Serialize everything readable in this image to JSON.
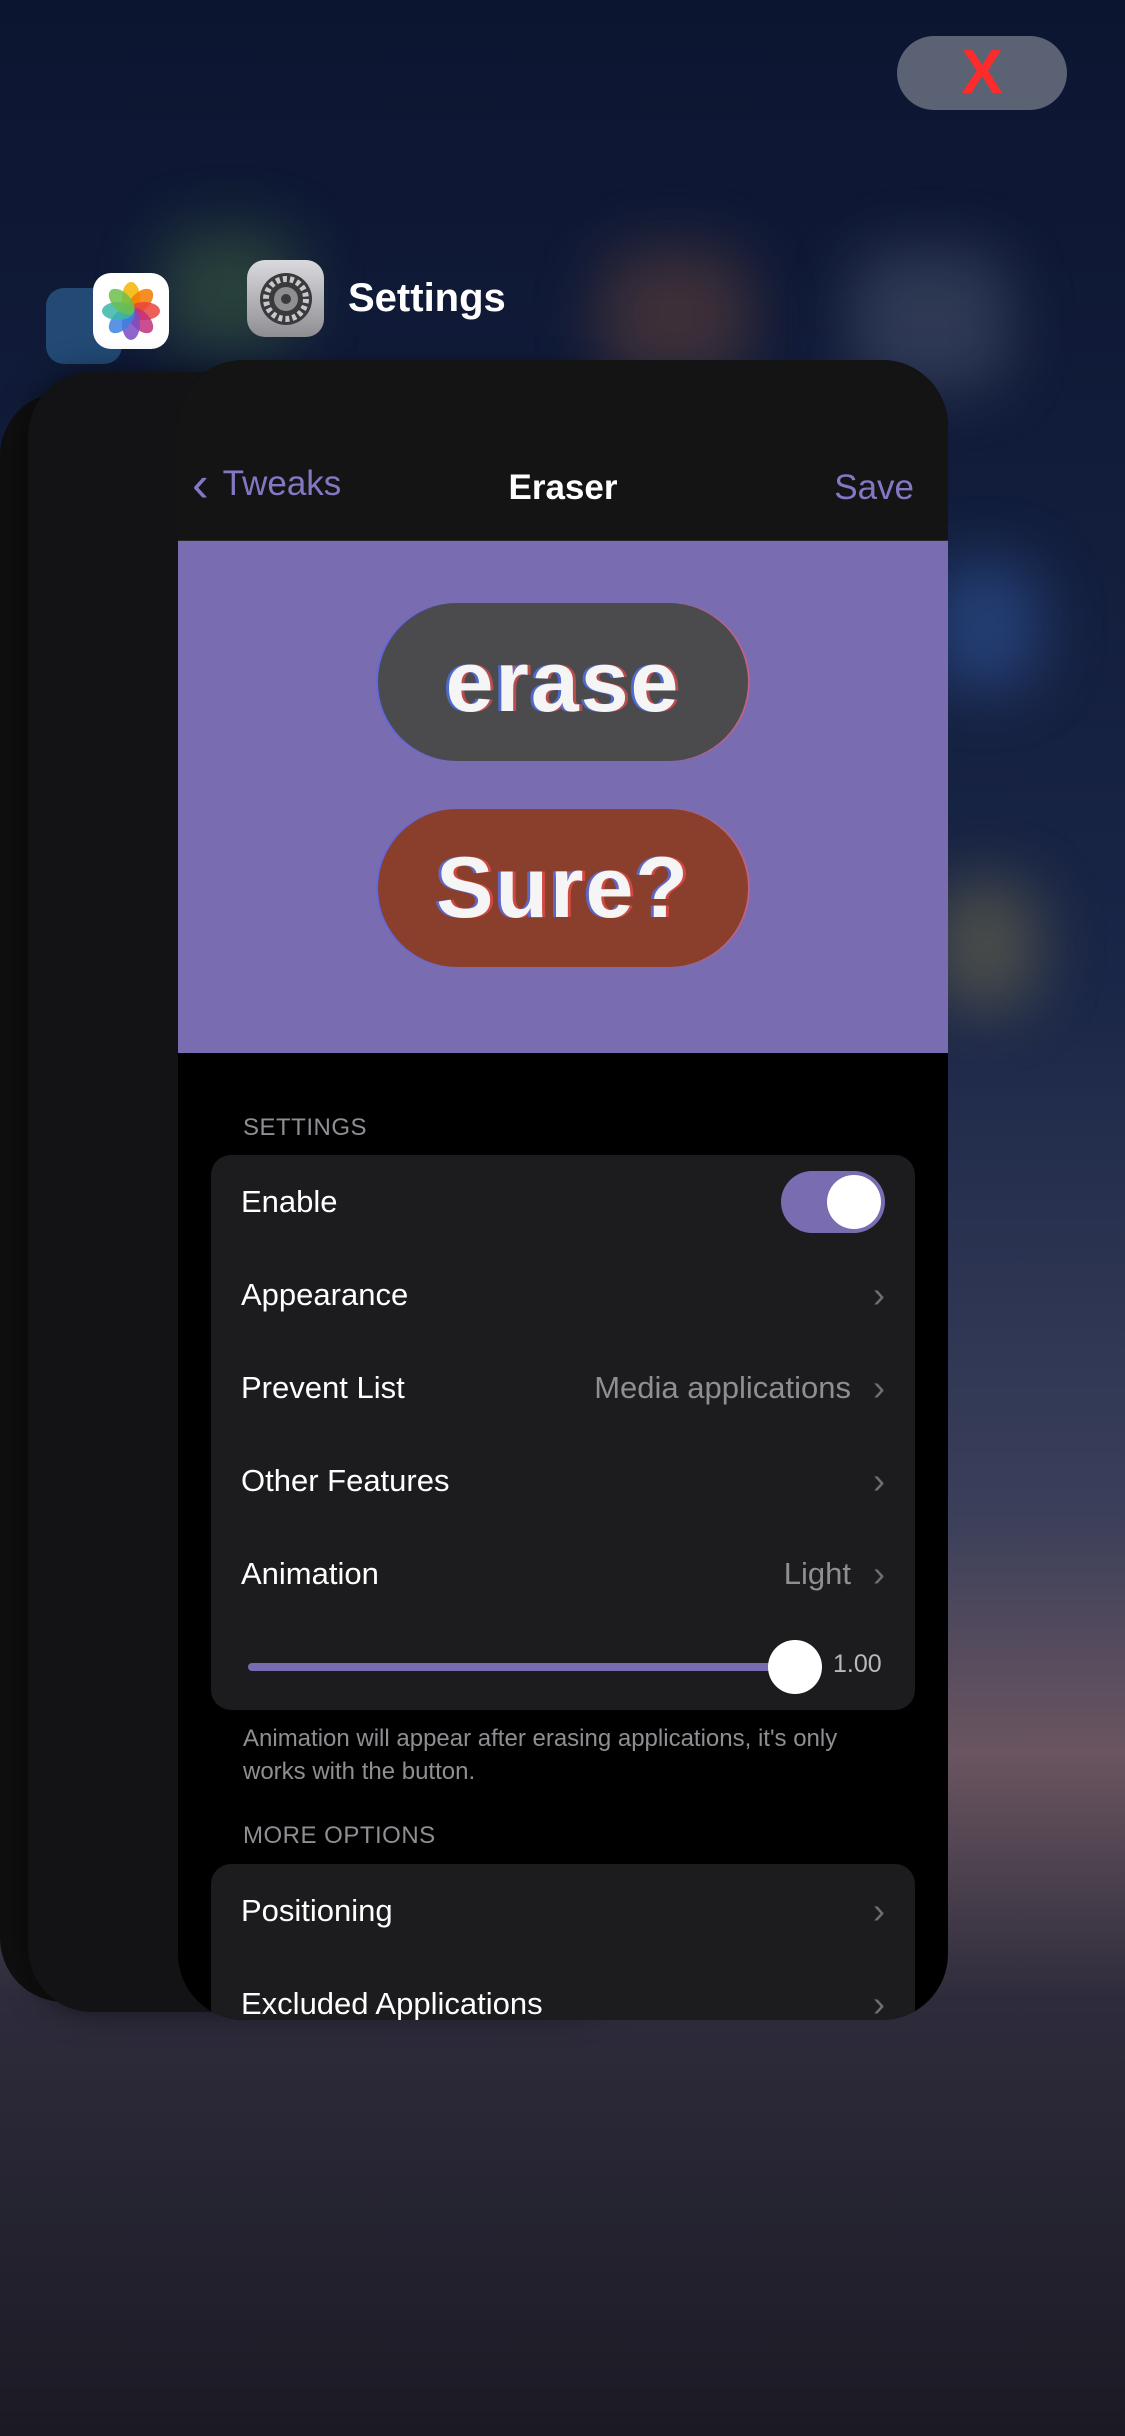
{
  "close_button": {
    "label": "X",
    "icon": "close-icon",
    "color": "#ff2a2a"
  },
  "app_switcher": {
    "current_app": "Settings",
    "other_apps": [
      "photos-icon",
      "files-icon"
    ]
  },
  "nav": {
    "back_label": "Tweaks",
    "title": "Eraser",
    "save_label": "Save"
  },
  "banner": {
    "erase_label": "erase",
    "sure_label": "Sure?",
    "background_color": "#7a6cb0"
  },
  "settings_section": {
    "header": "SETTINGS",
    "enable": {
      "label": "Enable",
      "on": true
    },
    "appearance": {
      "label": "Appearance"
    },
    "prevent_list": {
      "label": "Prevent List",
      "value": "Media applications"
    },
    "other_features": {
      "label": "Other Features"
    },
    "animation": {
      "label": "Animation",
      "value": "Light"
    },
    "slider": {
      "value": "1.00",
      "fraction": 1.0
    }
  },
  "footnote": "Animation will appear after erasing applications, it's only works with the button.",
  "more_section": {
    "header": "MORE OPTIONS",
    "positioning": {
      "label": "Positioning"
    },
    "excluded": {
      "label": "Excluded Applications"
    }
  },
  "colors": {
    "accent": "#7a6cb0",
    "link": "#8478c4"
  }
}
